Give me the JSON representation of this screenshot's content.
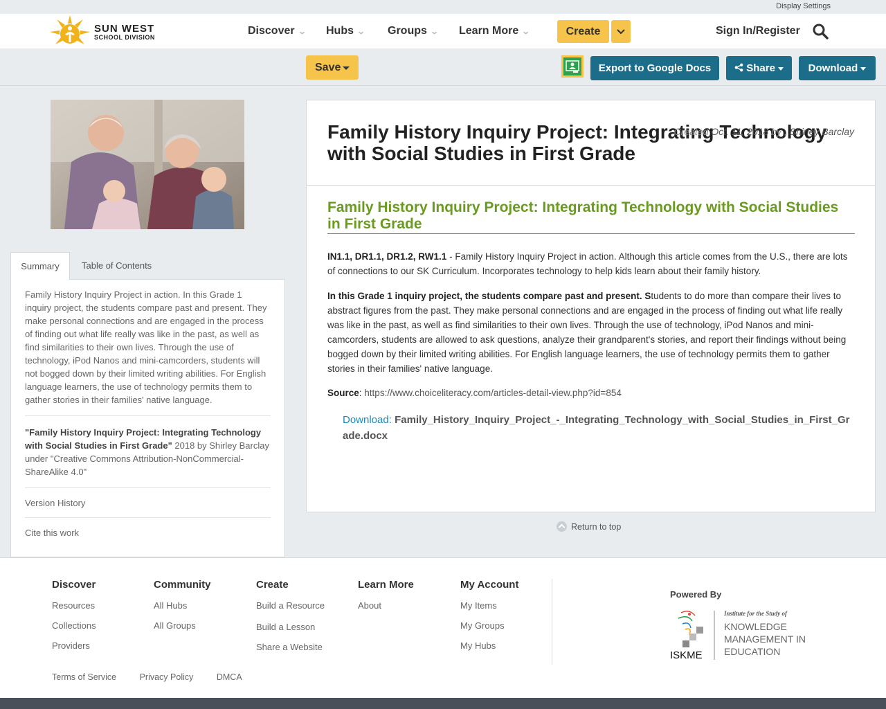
{
  "top": {
    "display_settings": "Display Settings"
  },
  "brand": {
    "name_line1": "SUN WEST",
    "name_line2": "SCHOOL DIVISION"
  },
  "nav": {
    "items": [
      "Discover",
      "Hubs",
      "Groups",
      "Learn More"
    ],
    "create": "Create",
    "signin": "Sign In/Register"
  },
  "toolbar": {
    "save": "Save",
    "export": "Export to Google Docs",
    "share": "Share",
    "download": "Download"
  },
  "sidebar": {
    "tabs": [
      "Summary",
      "Table of Contents"
    ],
    "summary": "Family History Inquiry Project in action. In this Grade 1 inquiry project, the students compare past and present. They make personal connections and are engaged in the process of finding out what life really was like in the past, as well as find similarities to their own lives. Through the use of technology, iPod Nanos and mini-camcorders, students will not bogged down by their limited writing abilities. For English language learners, the use of technology permits them to gather stories in their families' native language.",
    "citation_title": "\"Family History Inquiry Project: Integrating Technology with Social Studies in First Grade\"",
    "citation_rest": " 2018 by Shirley Barclay under \"Creative Commons Attribution-NonCommercial-ShareAlike 4.0\"",
    "version_history": "Version History",
    "cite": "Cite this work"
  },
  "document": {
    "title": "Family History Inquiry Project: Integrating Technology with Social Studies in First Grade",
    "created_label": "Created",
    "created_date": "Oct. 11, 2018",
    "by_label": "by ,",
    "author": "Shirley Barclay",
    "section_title": "Family History Inquiry Project: Integrating Technology with Social Studies in First Grade",
    "p1_bold": "IN1.1, DR1.1, DR1.2, RW1.1",
    "p1_text": " - Family History Inquiry Project in action. Although this article comes from the U.S., there are lots of connections to our SK Curriculum. Incorporates technology to help kids learn about their family history.",
    "p2_bold": "In this Grade 1 inquiry project, the students compare past and present.  S",
    "p2_text": "tudents to do more than compare their lives to abstract figures from the past. They make personal connections and are engaged in the process of finding out what life really was like in the past, as well as find similarities to their own lives. Through the use of technology, iPod Nanos and mini-camcorders, students are allowed to ask questions, analyze their grandparent's stories, and report their findings without being bogged down by their limited writing abilities. For English language learners, the use of technology permits them to gather stories in their families' native language.",
    "source_label": "Source",
    "source_url": "https://www.choiceliteracy.com/articles-detail-view.php?id=854",
    "download_label": "Download:",
    "download_file": "Family_History_Inquiry_Project_-_Integrating_Technology_with_Social_Studies_in_First_Grade.docx"
  },
  "return_top": "Return to top",
  "footer": {
    "columns": [
      {
        "heading": "Discover",
        "links": [
          "Resources",
          "Collections",
          "Providers"
        ]
      },
      {
        "heading": "Community",
        "links": [
          "All Hubs",
          "All Groups"
        ]
      },
      {
        "heading": "Create",
        "links": [
          "Build a Resource",
          "Build a Lesson",
          "Share a Website"
        ]
      },
      {
        "heading": "Learn More",
        "links": [
          "About"
        ]
      },
      {
        "heading": "My Account",
        "links": [
          "My Items",
          "My Groups",
          "My Hubs"
        ]
      }
    ],
    "powered_by": "Powered By",
    "iskme": {
      "tagline": "Institute for the Study of",
      "line1": "KNOWLEDGE",
      "line2": "MANAGEMENT IN",
      "line3": "EDUCATION",
      "mark": "ISKME"
    },
    "legal": [
      "Terms of Service",
      "Privacy Policy",
      "DMCA"
    ]
  },
  "colors": {
    "accent_yellow": "#f6c44a",
    "teal": "#1b6d8a",
    "green_title": "#6a9a1f",
    "link_blue": "#1b8bb7"
  }
}
